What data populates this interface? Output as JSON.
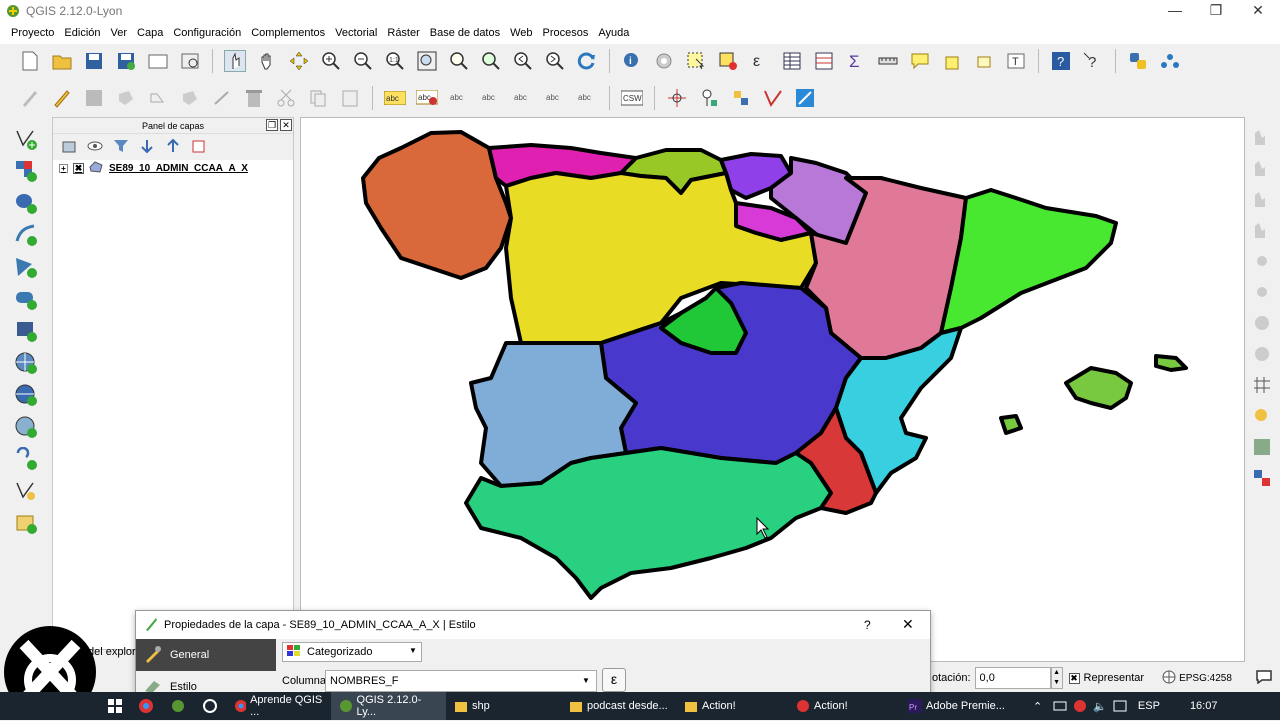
{
  "window": {
    "title": "QGIS 2.12.0-Lyon"
  },
  "menu": [
    "Proyecto",
    "Edición",
    "Ver",
    "Capa",
    "Configuración",
    "Complementos",
    "Vectorial",
    "Ráster",
    "Base de datos",
    "Web",
    "Procesos",
    "Ayuda"
  ],
  "layers_panel": {
    "title": "Panel de capas",
    "layer_name": "SE89_10_ADMIN_CCAA_A_X",
    "tab_fragment": "del explor"
  },
  "dialog": {
    "title": "Propiedades de la capa - SE89_10_ADMIN_CCAA_A_X | Estilo",
    "help": "?",
    "close": "✕",
    "sidebar": [
      "General",
      "Estilo"
    ],
    "renderer": "Categorizado",
    "column_label": "Columna",
    "column_value": "NOMBRES_F",
    "expr_button": "ε"
  },
  "status": {
    "rotation_label": "otación:",
    "rotation_value": "0,0",
    "render_label": "Representar",
    "crs": "EPSG:4258"
  },
  "taskbar": {
    "items": [
      "Aprende QGIS ...",
      "QGIS 2.12.0-Ly...",
      "shp",
      "podcast desde...",
      "Action!",
      "Action!",
      "Adobe Premie..."
    ],
    "lang": "ESP",
    "time": "16:07"
  },
  "colors": {
    "galicia": "#d9693a",
    "asturias": "#e020b0",
    "cantabria": "#98c826",
    "pais_vasco": "#9040e8",
    "navarra": "#b878d8",
    "rioja": "#d83ad8",
    "castilla_leon": "#e8dc24",
    "aragon": "#e07898",
    "cataluna": "#48e830",
    "madrid": "#20c838",
    "castilla_mancha": "#4838cc",
    "extremadura": "#80acd8",
    "valencia": "#38d0e0",
    "andalucia": "#28d080",
    "murcia": "#d83838",
    "baleares": "#78c840"
  }
}
